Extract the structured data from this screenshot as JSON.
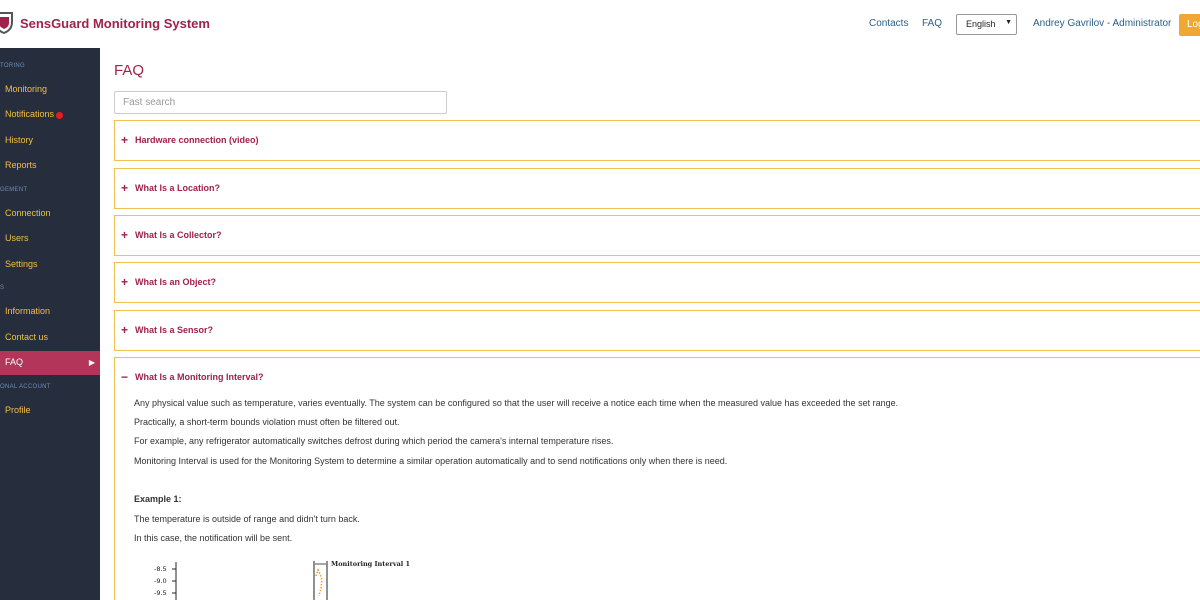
{
  "header": {
    "brand": "SensGuard Monitoring System",
    "contacts": "Contacts",
    "faq": "FAQ",
    "language": "English",
    "user": "Andrey Gavrilov - Administrator",
    "logout": "Log"
  },
  "sidebar": {
    "sections": [
      "TORING",
      "GEMENT",
      "S",
      "ONAL ACCOUNT"
    ],
    "items": [
      {
        "label": "Monitoring"
      },
      {
        "label": "Notifications"
      },
      {
        "label": "History"
      },
      {
        "label": "Reports"
      },
      {
        "label": "Connection"
      },
      {
        "label": "Users"
      },
      {
        "label": "Settings"
      },
      {
        "label": "Information"
      },
      {
        "label": "Contact us"
      },
      {
        "label": "FAQ"
      },
      {
        "label": "Profile"
      }
    ]
  },
  "main": {
    "title": "FAQ",
    "search_placeholder": "Fast search",
    "faq_items": [
      {
        "sign": "+",
        "question": "Hardware connection (video)"
      },
      {
        "sign": "+",
        "question": "What Is a Location?"
      },
      {
        "sign": "+",
        "question": "What Is a Collector?"
      },
      {
        "sign": "+",
        "question": "What Is an Object?"
      },
      {
        "sign": "+",
        "question": "What Is a Sensor?"
      },
      {
        "sign": "−",
        "question": "What Is a Monitoring Interval?"
      }
    ],
    "answer": {
      "p1": "Any physical value such as temperature, varies eventually. The system can be configured so that the user will receive a notice each time when the measured value has exceeded the set range.",
      "p2": "Practically, a short-term bounds violation must often be filtered out.",
      "p3": "For example, any refrigerator automatically switches defrost during which period the camera's internal temperature rises.",
      "p4": "Monitoring Interval is used for the Monitoring System to determine a similar operation automatically and to send notifications only when there is need.",
      "example_title": "Example 1:",
      "example_p1": "The temperature is outside of range and didn't turn back.",
      "example_p2": "In this case, the notification will be sent.",
      "chart_ticks": [
        "-8.5",
        "-9.0",
        "-9.5"
      ],
      "chart_interval_label": "Monitoring Interval 1"
    }
  },
  "colors": {
    "accent": "#a0224a",
    "sidebar_bg": "#262d3d",
    "sidebar_active": "#b3355a",
    "sidebar_text": "#f0c040",
    "faq_border": "#f0c050",
    "logout_bg": "#f0a832",
    "link": "#2b5f8a"
  },
  "icons": [
    "shield-logo-icon",
    "dropdown-arrow-icon",
    "notification-dot-icon",
    "chevron-right-icon",
    "plus-icon",
    "minus-icon"
  ]
}
